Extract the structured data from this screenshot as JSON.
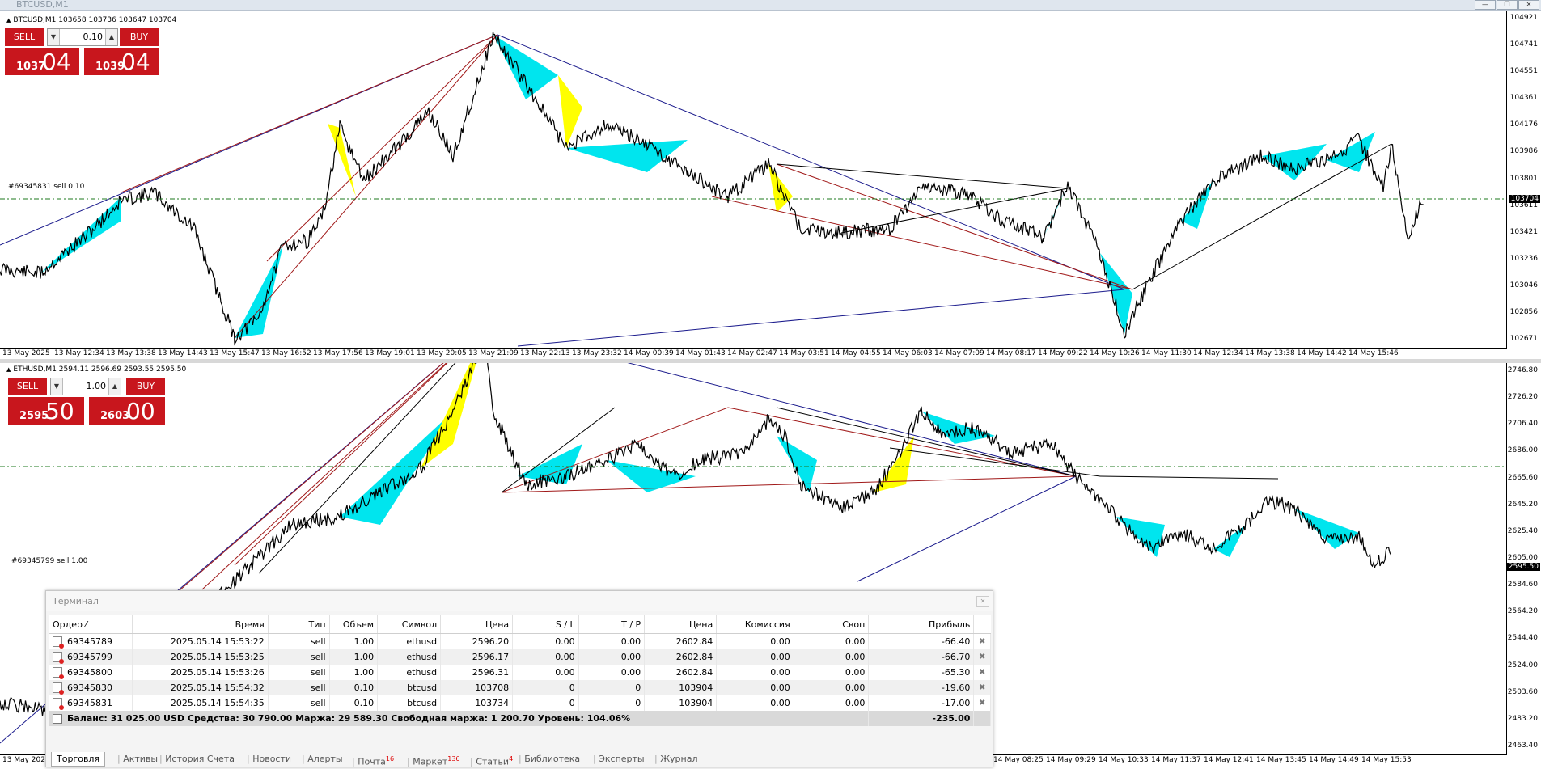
{
  "window": {
    "title": "BTCUSD,M1"
  },
  "chart1": {
    "symbol_line": "BTCUSD,M1  103658 103736 103647 103704",
    "order_label": "#69345831 sell 0.10",
    "current_price": "103704",
    "price_ticks": [
      "104921",
      "104741",
      "104551",
      "104361",
      "104176",
      "103986",
      "103801",
      "103611",
      "103421",
      "103236",
      "103046",
      "102856",
      "102671"
    ],
    "time_ticks": [
      "13 May 2025",
      "13 May 12:34",
      "13 May 13:38",
      "13 May 14:43",
      "13 May 15:47",
      "13 May 16:52",
      "13 May 17:56",
      "13 May 19:01",
      "13 May 20:05",
      "13 May 21:09",
      "13 May 22:13",
      "13 May 23:32",
      "14 May 00:39",
      "14 May 01:43",
      "14 May 02:47",
      "14 May 03:51",
      "14 May 04:55",
      "14 May 06:03",
      "14 May 07:09",
      "14 May 08:17",
      "14 May 09:22",
      "14 May 10:26",
      "14 May 11:30",
      "14 May 12:34",
      "14 May 13:38",
      "14 May 14:42",
      "14 May 15:46"
    ],
    "trade": {
      "sell_label": "SELL",
      "buy_label": "BUY",
      "lot": "0.10",
      "sell_small": "1037",
      "sell_big": "04",
      "buy_small": "1039",
      "buy_big": "04"
    }
  },
  "chart2": {
    "symbol_line": "ETHUSD,M1  2594.11 2596.69 2593.55 2595.50",
    "order_label": "#69345799 sell 1.00",
    "current_price": "2595.50",
    "price_ticks": [
      "2746.80",
      "2726.20",
      "2706.40",
      "2686.00",
      "2665.60",
      "2645.20",
      "2625.40",
      "2605.00",
      "2584.60",
      "2564.20",
      "2544.40",
      "2524.00",
      "2503.60",
      "2483.20",
      "2463.40"
    ],
    "time_ticks_left": [
      "13 May 202"
    ],
    "time_ticks_right": [
      "14 May 08:25",
      "14 May 09:29",
      "14 May 10:33",
      "14 May 11:37",
      "14 May 12:41",
      "14 May 13:45",
      "14 May 14:49",
      "14 May 15:53"
    ],
    "trade": {
      "sell_label": "SELL",
      "buy_label": "BUY",
      "lot": "1.00",
      "sell_small": "2595",
      "sell_big": "50",
      "buy_small": "2603",
      "buy_big": "00"
    }
  },
  "terminal": {
    "title": "Терминал",
    "headers": [
      "Ордер  ⁄",
      "Время",
      "Тип",
      "Объем",
      "Символ",
      "Цена",
      "S / L",
      "T / P",
      "Цена",
      "Комиссия",
      "Своп",
      "Прибыль"
    ],
    "rows": [
      {
        "order": "69345789",
        "time": "2025.05.14 15:53:22",
        "type": "sell",
        "volume": "1.00",
        "symbol": "ethusd",
        "price": "2596.20",
        "sl": "0.00",
        "tp": "0.00",
        "cur": "2602.84",
        "commission": "0.00",
        "swap": "0.00",
        "profit": "-66.40"
      },
      {
        "order": "69345799",
        "time": "2025.05.14 15:53:25",
        "type": "sell",
        "volume": "1.00",
        "symbol": "ethusd",
        "price": "2596.17",
        "sl": "0.00",
        "tp": "0.00",
        "cur": "2602.84",
        "commission": "0.00",
        "swap": "0.00",
        "profit": "-66.70"
      },
      {
        "order": "69345800",
        "time": "2025.05.14 15:53:26",
        "type": "sell",
        "volume": "1.00",
        "symbol": "ethusd",
        "price": "2596.31",
        "sl": "0.00",
        "tp": "0.00",
        "cur": "2602.84",
        "commission": "0.00",
        "swap": "0.00",
        "profit": "-65.30"
      },
      {
        "order": "69345830",
        "time": "2025.05.14 15:54:32",
        "type": "sell",
        "volume": "0.10",
        "symbol": "btcusd",
        "price": "103708",
        "sl": "0",
        "tp": "0",
        "cur": "103904",
        "commission": "0.00",
        "swap": "0.00",
        "profit": "-19.60"
      },
      {
        "order": "69345831",
        "time": "2025.05.14 15:54:35",
        "type": "sell",
        "volume": "0.10",
        "symbol": "btcusd",
        "price": "103734",
        "sl": "0",
        "tp": "0",
        "cur": "103904",
        "commission": "0.00",
        "swap": "0.00",
        "profit": "-17.00"
      }
    ],
    "summary": {
      "text": "Баланс: 31 025.00 USD  Средства: 30 790.00  Маржа: 29 589.30  Свободная маржа: 1 200.70  Уровень: 104.06%",
      "total": "-235.00"
    },
    "tabs": [
      {
        "label": "Торговля",
        "badge": ""
      },
      {
        "label": "Активы",
        "badge": ""
      },
      {
        "label": "История Счета",
        "badge": ""
      },
      {
        "label": "Новости",
        "badge": ""
      },
      {
        "label": "Алерты",
        "badge": ""
      },
      {
        "label": "Почта",
        "badge": "16"
      },
      {
        "label": "Маркет",
        "badge": "136"
      },
      {
        "label": "Статьи",
        "badge": "4"
      },
      {
        "label": "Библиотека",
        "badge": ""
      },
      {
        "label": "Эксперты",
        "badge": ""
      },
      {
        "label": "Журнал",
        "badge": ""
      }
    ]
  },
  "colors": {
    "sell": "#c8161d",
    "buy": "#c8161d",
    "candle": "#000000",
    "fill_a": "#00e5ee",
    "fill_b": "#ffff00",
    "fill_c": "#00cc00",
    "line_blue": "#1a1a8c",
    "line_red": "#a01818",
    "order_line": "#1e7a1e"
  }
}
